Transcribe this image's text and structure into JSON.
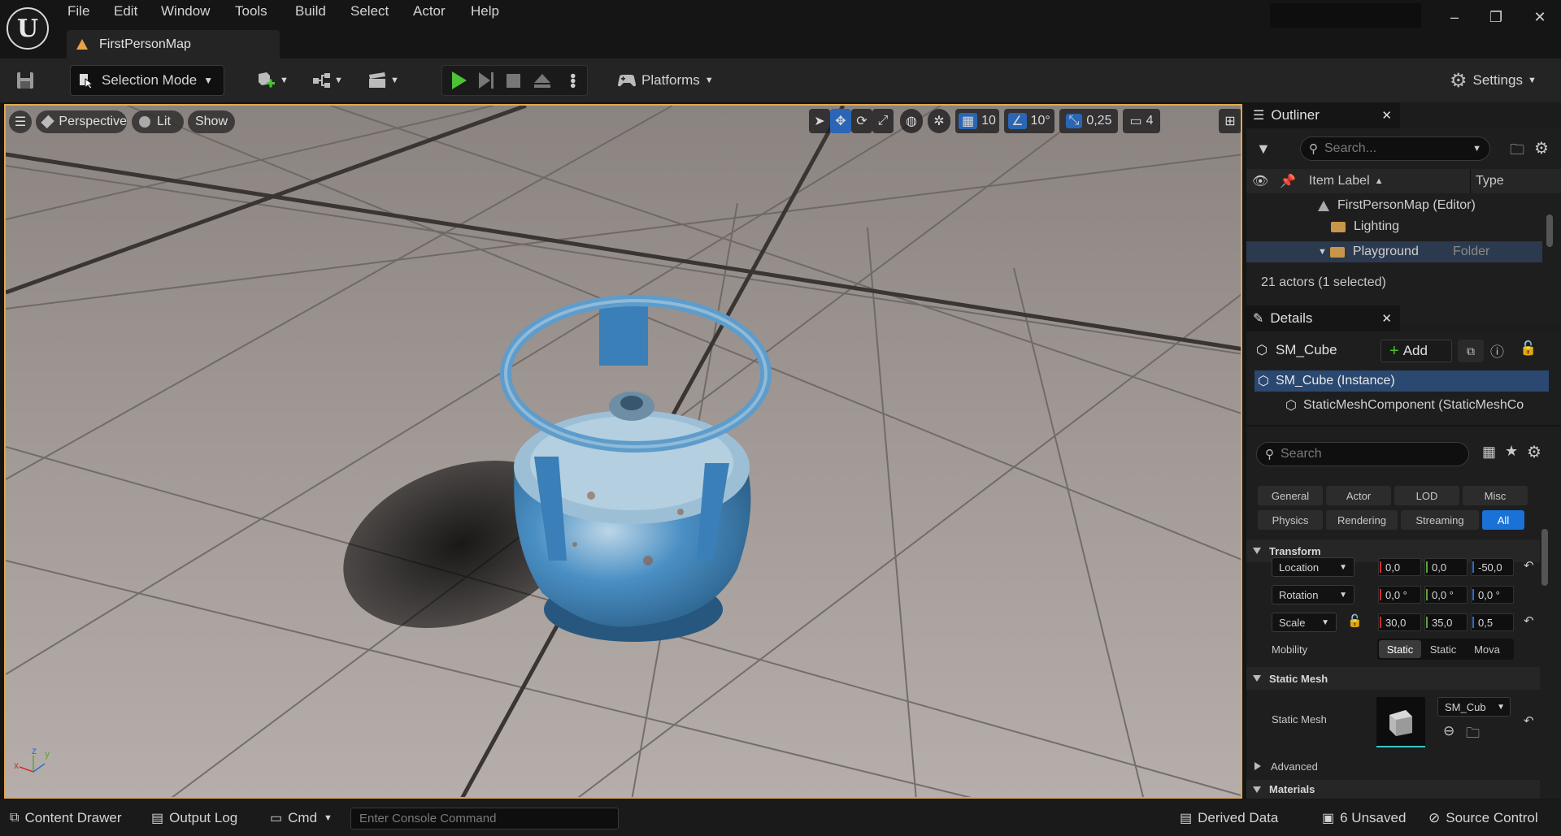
{
  "menubar": {
    "logo_letter": "U",
    "items": [
      "File",
      "Edit",
      "Window",
      "Tools",
      "Build",
      "Select",
      "Actor",
      "Help"
    ],
    "tab_label": "FirstPersonMap",
    "window_buttons": [
      "–",
      "❐",
      "✕"
    ]
  },
  "toolbar": {
    "selection_mode": "Selection Mode",
    "platforms": "Platforms",
    "settings": "Settings"
  },
  "viewport": {
    "perspective": "Perspective",
    "lit": "Lit",
    "show": "Show",
    "grid_snap": "10",
    "rotation_snap": "10°",
    "scale_snap": "0,25",
    "camera_speed": "4",
    "axis_x": "x",
    "axis_z": "z",
    "axis_y": "y"
  },
  "outliner": {
    "title": "Outliner",
    "search_placeholder": "Search...",
    "col_label": "Item Label",
    "col_type": "Type",
    "rows": [
      {
        "label": "FirstPersonMap (Editor)",
        "type": ""
      },
      {
        "label": "Lighting",
        "type": ""
      },
      {
        "label": "Playground",
        "type": "Folder"
      }
    ],
    "status": "21 actors (1 selected)"
  },
  "details": {
    "title": "Details",
    "actor_name": "SM_Cube",
    "add_label": "Add",
    "components": [
      "SM_Cube (Instance)",
      "StaticMeshComponent (StaticMeshCo"
    ],
    "search_placeholder": "Search",
    "categories": [
      "General",
      "Actor",
      "LOD",
      "Misc",
      "Physics",
      "Rendering",
      "Streaming",
      "All"
    ],
    "transform_header": "Transform",
    "location_label": "Location",
    "location": [
      "0,0",
      "0,0",
      "-50,0"
    ],
    "rotation_label": "Rotation",
    "rotation": [
      "0,0 °",
      "0,0 °",
      "0,0 °"
    ],
    "scale_label": "Scale",
    "scale": [
      "30,0",
      "35,0",
      "0,5"
    ],
    "mobility_label": "Mobility",
    "mobility_options": [
      "Static",
      "Static",
      "Mova"
    ],
    "static_mesh_header": "Static Mesh",
    "static_mesh_label": "Static Mesh",
    "static_mesh_value": "SM_Cub",
    "advanced_label": "Advanced",
    "materials_header": "Materials"
  },
  "statusbar": {
    "content_drawer": "Content Drawer",
    "output_log": "Output Log",
    "cmd": "Cmd",
    "console_placeholder": "Enter Console Command",
    "derived_data": "Derived Data",
    "unsaved": "6 Unsaved",
    "source_control": "Source Control"
  },
  "colors": {
    "accent_blue": "#1a72d6",
    "viewport_border": "#e2a64a",
    "play_green": "#4cc234",
    "cylinder_blue": "#4a8fc4"
  }
}
